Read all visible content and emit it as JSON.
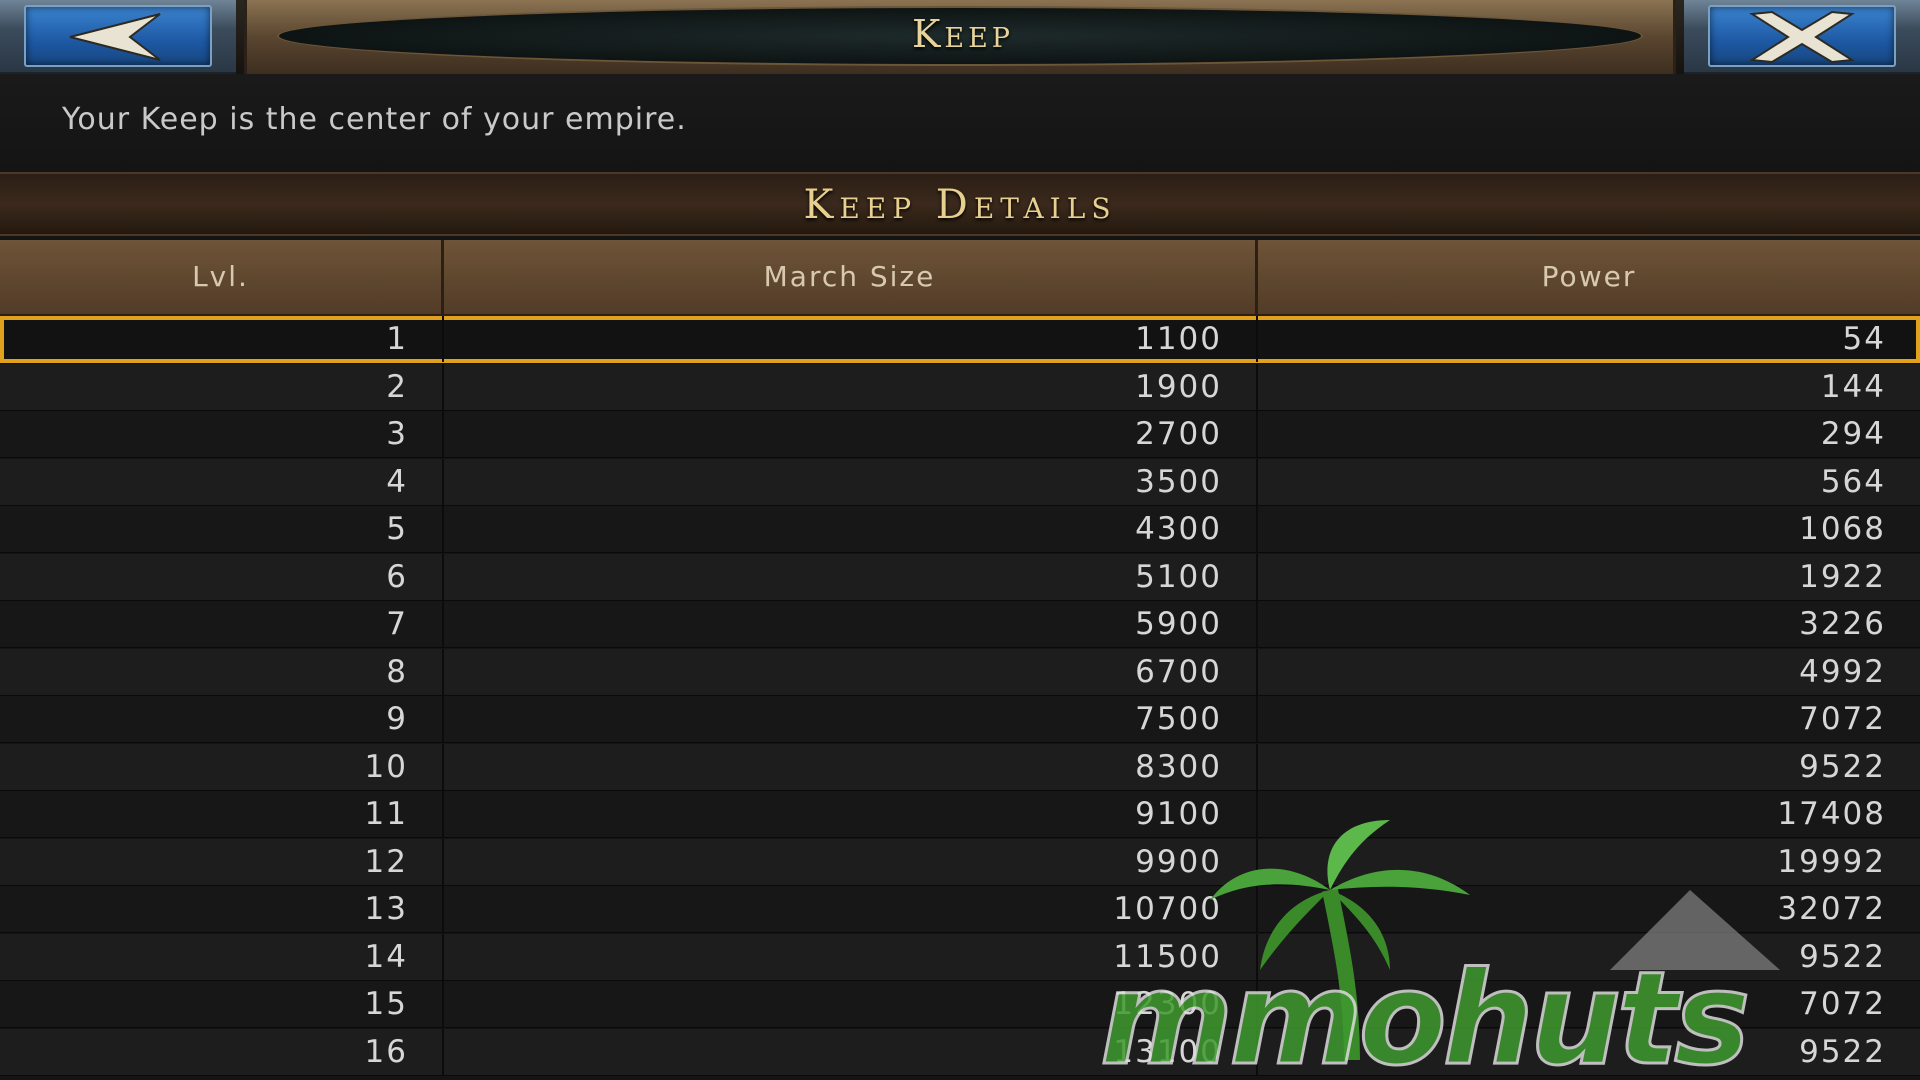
{
  "header": {
    "title": "Keep",
    "back_icon": "back-arrow-icon",
    "close_icon": "close-x-icon"
  },
  "description": "Your Keep is the center of your empire.",
  "section_title": "Keep Details",
  "table": {
    "columns": [
      "Lvl.",
      "March Size",
      "Power"
    ],
    "rows": [
      {
        "lvl": "1",
        "march": "1100",
        "power": "54"
      },
      {
        "lvl": "2",
        "march": "1900",
        "power": "144"
      },
      {
        "lvl": "3",
        "march": "2700",
        "power": "294"
      },
      {
        "lvl": "4",
        "march": "3500",
        "power": "564"
      },
      {
        "lvl": "5",
        "march": "4300",
        "power": "1068"
      },
      {
        "lvl": "6",
        "march": "5100",
        "power": "1922"
      },
      {
        "lvl": "7",
        "march": "5900",
        "power": "3226"
      },
      {
        "lvl": "8",
        "march": "6700",
        "power": "4992"
      },
      {
        "lvl": "9",
        "march": "7500",
        "power": "7072"
      },
      {
        "lvl": "10",
        "march": "8300",
        "power": "9522"
      },
      {
        "lvl": "11",
        "march": "9100",
        "power": "17408"
      },
      {
        "lvl": "12",
        "march": "9900",
        "power": "19992"
      },
      {
        "lvl": "13",
        "march": "10700",
        "power": "32072"
      },
      {
        "lvl": "14",
        "march": "11500",
        "power": "9522"
      },
      {
        "lvl": "15",
        "march": "12300",
        "power": "7072"
      },
      {
        "lvl": "16",
        "march": "13100",
        "power": "9522"
      }
    ],
    "selected_row": 0
  },
  "watermark": {
    "text": "mmohuts",
    "icon": "palm-tree-logo-icon"
  },
  "colors": {
    "accent_gold": "#e0a21c",
    "header_blue": "#1d58a3",
    "title_text": "#e8d39a"
  }
}
